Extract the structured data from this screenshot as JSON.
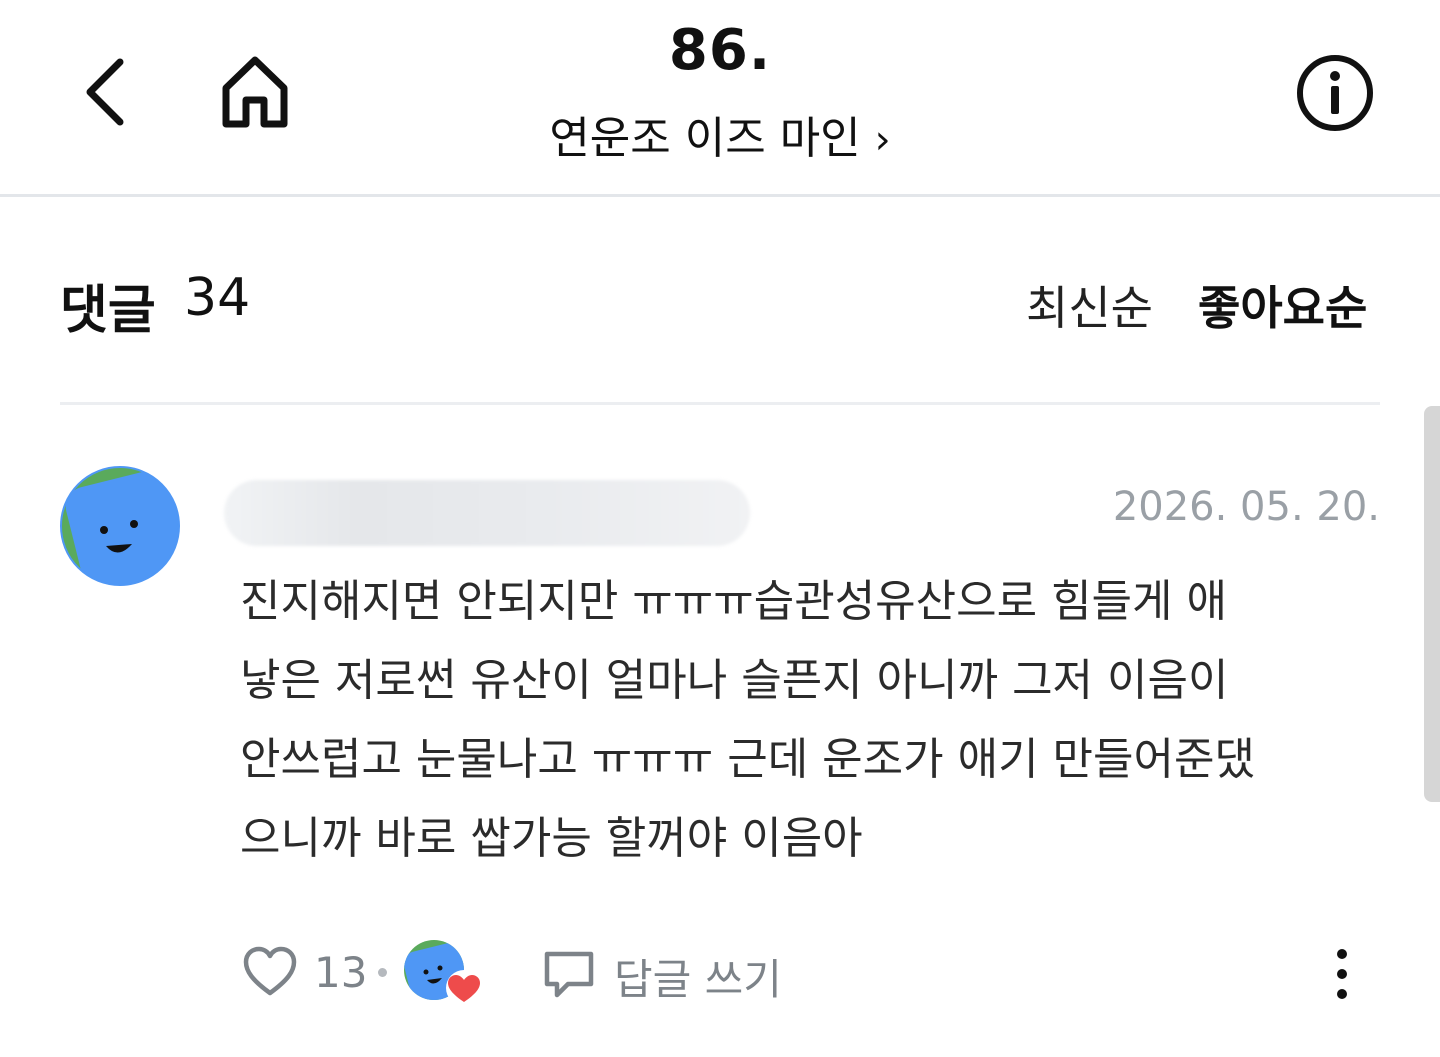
{
  "header": {
    "episode_title": "86.",
    "series_title": "연운조 이즈 마인",
    "series_chevron": "›"
  },
  "comments": {
    "label": "댓글",
    "count": "34",
    "sort_latest": "최신순",
    "sort_likes": "좋아요순"
  },
  "comment": {
    "date": "2026. 05. 20.",
    "lines": [
      "진지해지면 안되지만 ㅠㅠㅠ습관성유산으로 힘들게 애",
      "낳은 저로썬 유산이 얼마나 슬픈지 아니까 그저 이음이",
      "안쓰럽고 눈물나고 ㅠㅠㅠ 근데 운조가 애기 만들어준댔",
      "으니까 바로 쌉가능 할꺼야 이음아"
    ],
    "like_count": "13",
    "reply_label": "답글 쓰기"
  },
  "colors": {
    "avatar_blue": "#4f97f5",
    "avatar_green": "#5aaa5c",
    "heart_red": "#ee4b4b",
    "muted_text": "#7d8389",
    "date_text": "#9aa0a6"
  },
  "icons": {
    "back": "chevron-left-icon",
    "home": "home-icon",
    "info": "info-icon",
    "like": "heart-outline-icon",
    "reply": "speech-bubble-icon",
    "more": "vertical-dots-icon"
  }
}
